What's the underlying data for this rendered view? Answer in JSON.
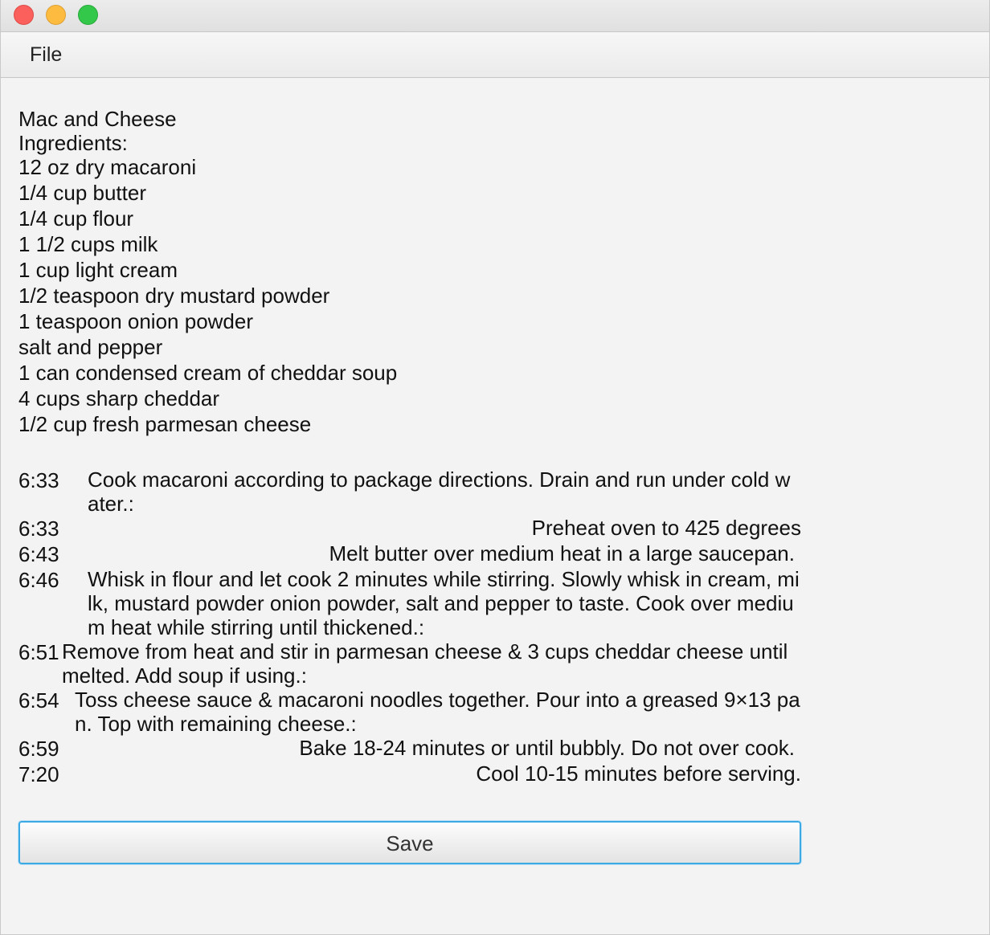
{
  "window": {
    "buttons": {
      "close_color": "#fc605c",
      "minimize_color": "#fdbc40",
      "maximize_color": "#34c84a"
    }
  },
  "menubar": {
    "file_label": "File"
  },
  "recipe": {
    "title": "Mac and Cheese",
    "ingredients_header": "Ingredients:",
    "ingredients": [
      "12 oz dry macaroni",
      "1/4 cup butter",
      "1/4 cup flour",
      "1 1/2 cups milk",
      "1 cup light cream",
      "1/2 teaspoon dry mustard powder",
      "1 teaspoon onion powder",
      "salt and pepper",
      "1 can condensed cream of cheddar soup",
      "4 cups sharp cheddar",
      "1/2 cup fresh parmesan cheese"
    ],
    "steps": [
      {
        "time": "6:33",
        "text": "Cook macaroni according to package directions. Drain and run under cold water.:"
      },
      {
        "time": "6:33",
        "text": "Preheat oven to 425 degrees"
      },
      {
        "time": "6:43",
        "text": "Melt butter over medium heat in a large saucepan."
      },
      {
        "time": "6:46",
        "text": "Whisk in flour and let cook 2 minutes while stirring. Slowly whisk in cream, milk, mustard powder onion powder, salt and pepper to taste. Cook over medium heat while stirring until thickened.:"
      },
      {
        "time": "6:51",
        "text": "Remove from heat and stir in parmesan cheese & 3 cups cheddar cheese until melted. Add soup if using.:"
      },
      {
        "time": "6:54",
        "text": "Toss cheese sauce & macaroni noodles together. Pour into a greased 9×13 pan. Top with remaining cheese.:"
      },
      {
        "time": "6:59",
        "text": "Bake 18-24 minutes or until bubbly. Do not over cook."
      },
      {
        "time": "7:20",
        "text": "Cool 10-15 minutes before serving."
      }
    ]
  },
  "save_button": {
    "label": "Save"
  }
}
